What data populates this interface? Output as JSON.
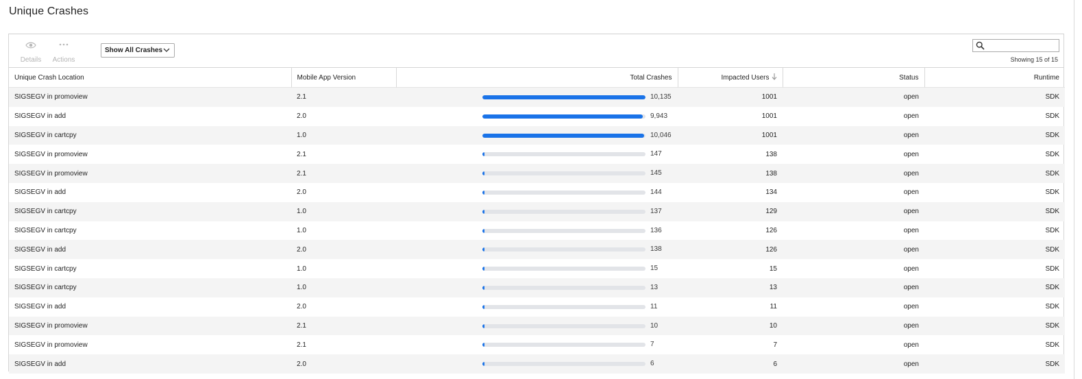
{
  "page": {
    "title": "Unique Crashes"
  },
  "toolbar": {
    "details_label": "Details",
    "actions_label": "Actions",
    "filter_selected": "Show All Crashes",
    "search_placeholder": "",
    "showing_text": "Showing 15 of 15"
  },
  "icons": {
    "details": "eye-icon",
    "actions": "more-dots-icon",
    "search": "search-icon",
    "dropdown": "chevron-down-icon",
    "sort": "arrow-down-icon"
  },
  "colors": {
    "bar_fill": "#1a73e8",
    "bar_track": "#e2e4e8",
    "row_alt": "#f4f4f4"
  },
  "table": {
    "columns": [
      "Unique Crash Location",
      "Mobile App Version",
      "Total Crashes",
      "Impacted Users",
      "Status",
      "Runtime"
    ],
    "sorted_column": "Impacted Users",
    "max_total_crashes": 10135,
    "rows": [
      {
        "location": "SIGSEGV in promoview",
        "version": "2.1",
        "total_crashes": 10135,
        "total_crashes_label": "10,135",
        "impacted_users": "1001",
        "status": "open",
        "runtime": "SDK"
      },
      {
        "location": "SIGSEGV in add",
        "version": "2.0",
        "total_crashes": 9943,
        "total_crashes_label": "9,943",
        "impacted_users": "1001",
        "status": "open",
        "runtime": "SDK"
      },
      {
        "location": "SIGSEGV in cartcpy",
        "version": "1.0",
        "total_crashes": 10046,
        "total_crashes_label": "10,046",
        "impacted_users": "1001",
        "status": "open",
        "runtime": "SDK"
      },
      {
        "location": "SIGSEGV in promoview",
        "version": "2.1",
        "total_crashes": 147,
        "total_crashes_label": "147",
        "impacted_users": "138",
        "status": "open",
        "runtime": "SDK"
      },
      {
        "location": "SIGSEGV in promoview",
        "version": "2.1",
        "total_crashes": 145,
        "total_crashes_label": "145",
        "impacted_users": "138",
        "status": "open",
        "runtime": "SDK"
      },
      {
        "location": "SIGSEGV in add",
        "version": "2.0",
        "total_crashes": 144,
        "total_crashes_label": "144",
        "impacted_users": "134",
        "status": "open",
        "runtime": "SDK"
      },
      {
        "location": "SIGSEGV in cartcpy",
        "version": "1.0",
        "total_crashes": 137,
        "total_crashes_label": "137",
        "impacted_users": "129",
        "status": "open",
        "runtime": "SDK"
      },
      {
        "location": "SIGSEGV in cartcpy",
        "version": "1.0",
        "total_crashes": 136,
        "total_crashes_label": "136",
        "impacted_users": "126",
        "status": "open",
        "runtime": "SDK"
      },
      {
        "location": "SIGSEGV in add",
        "version": "2.0",
        "total_crashes": 138,
        "total_crashes_label": "138",
        "impacted_users": "126",
        "status": "open",
        "runtime": "SDK"
      },
      {
        "location": "SIGSEGV in cartcpy",
        "version": "1.0",
        "total_crashes": 15,
        "total_crashes_label": "15",
        "impacted_users": "15",
        "status": "open",
        "runtime": "SDK"
      },
      {
        "location": "SIGSEGV in cartcpy",
        "version": "1.0",
        "total_crashes": 13,
        "total_crashes_label": "13",
        "impacted_users": "13",
        "status": "open",
        "runtime": "SDK"
      },
      {
        "location": "SIGSEGV in add",
        "version": "2.0",
        "total_crashes": 11,
        "total_crashes_label": "11",
        "impacted_users": "11",
        "status": "open",
        "runtime": "SDK"
      },
      {
        "location": "SIGSEGV in promoview",
        "version": "2.1",
        "total_crashes": 10,
        "total_crashes_label": "10",
        "impacted_users": "10",
        "status": "open",
        "runtime": "SDK"
      },
      {
        "location": "SIGSEGV in promoview",
        "version": "2.1",
        "total_crashes": 7,
        "total_crashes_label": "7",
        "impacted_users": "7",
        "status": "open",
        "runtime": "SDK"
      },
      {
        "location": "SIGSEGV in add",
        "version": "2.0",
        "total_crashes": 6,
        "total_crashes_label": "6",
        "impacted_users": "6",
        "status": "open",
        "runtime": "SDK"
      }
    ]
  }
}
